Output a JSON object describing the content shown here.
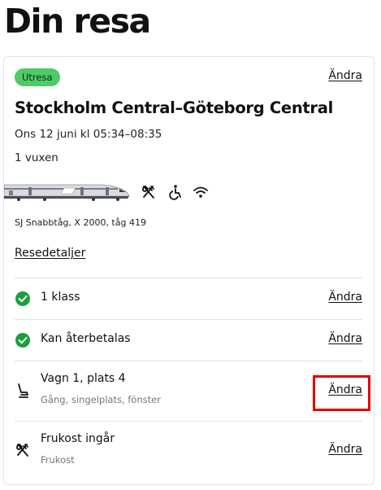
{
  "page": {
    "title": "Din resa"
  },
  "trip": {
    "badge": "Utresa",
    "edit_label": "Ändra",
    "route": "Stockholm Central–Göteborg Central",
    "datetime": "Ons 12 juni kl 05:34–08:35",
    "passengers": "1 vuxen",
    "amenities": [
      "cutlery-icon",
      "wheelchair-icon",
      "wifi-icon"
    ],
    "train_info": "SJ Snabbtåg, X 2000, tåg 419",
    "details_link": "Resedetaljer"
  },
  "options": [
    {
      "title": "1 klass",
      "subtitle": "",
      "icon": "check-circle-icon",
      "edit_label": "Ändra"
    },
    {
      "title": "Kan återbetalas",
      "subtitle": "",
      "icon": "check-circle-icon",
      "edit_label": "Ändra"
    },
    {
      "title": "Vagn 1, plats 4",
      "subtitle": "Gång, singelplats, fönster",
      "icon": "seat-icon",
      "edit_label": "Ändra"
    },
    {
      "title": "Frukost ingår",
      "subtitle": "Frukost",
      "icon": "cutlery-icon",
      "edit_label": "Ändra"
    }
  ],
  "colors": {
    "badge": "#4fcb66",
    "check": "#1c9e3c",
    "highlight": "#e00000"
  }
}
